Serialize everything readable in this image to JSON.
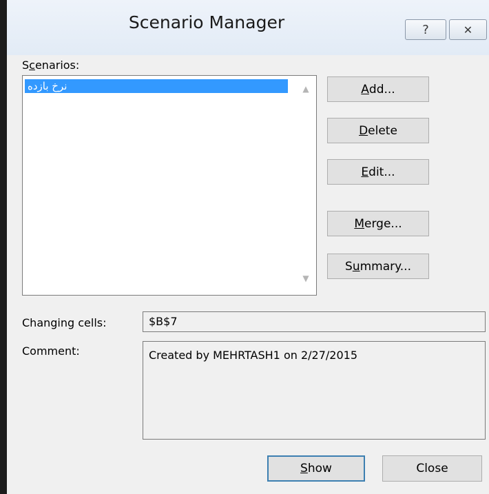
{
  "window": {
    "title": "Scenario Manager",
    "help_glyph": "?",
    "close_glyph": "✕"
  },
  "scenarios": {
    "label_pre": "S",
    "label_u": "c",
    "label_post": "enarios:",
    "items": [
      {
        "name": "نرخ بازده",
        "selected": true
      }
    ]
  },
  "buttons": {
    "add": {
      "u": "A",
      "rest": "dd..."
    },
    "delete": {
      "u": "D",
      "rest": "elete"
    },
    "edit": {
      "u": "E",
      "rest": "dit..."
    },
    "merge": {
      "u": "M",
      "rest": "erge..."
    },
    "summary": {
      "pre": "S",
      "u": "u",
      "rest": "mmary..."
    },
    "show": {
      "u": "S",
      "rest": "how"
    },
    "close": "Close"
  },
  "changing_cells": {
    "label": "Changing cells:",
    "value": "$B$7"
  },
  "comment": {
    "label": "Comment:",
    "value": "Created by MEHRTASH1 on 2/27/2015"
  },
  "colors": {
    "selection": "#3399ff",
    "default_button_border": "#3c7fb1"
  }
}
